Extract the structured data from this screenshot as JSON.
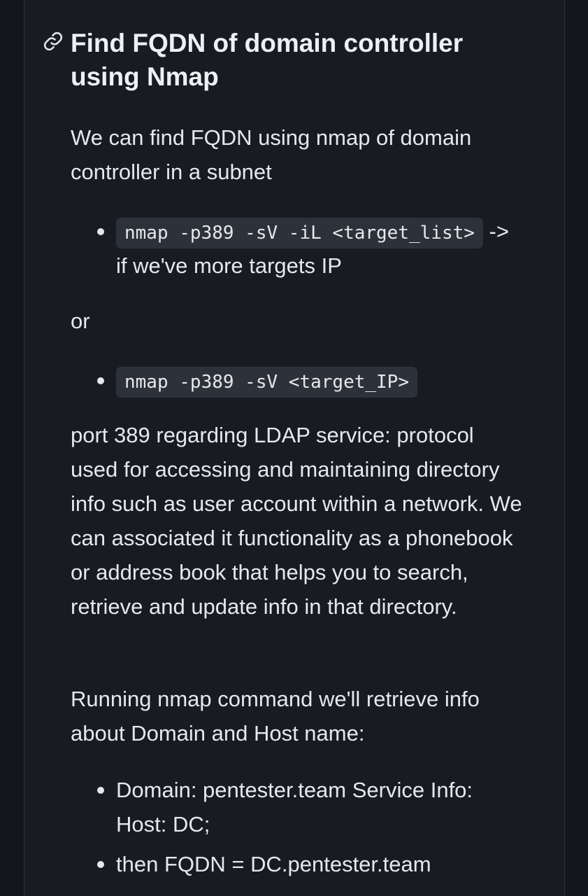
{
  "section": {
    "heading": "Find FQDN of domain controller using Nmap",
    "anchor_icon": "link-icon",
    "intro": "We can find FQDN using nmap of domain controller in a subnet",
    "list1": [
      {
        "code": "nmap -p389 -sV -iL <target_list>",
        "text": "-> if we've more targets IP"
      }
    ],
    "or_text": "or",
    "list2": [
      {
        "code": "nmap -p389 -sV <target_IP>"
      }
    ],
    "ldap_paragraph": "port 389 regarding LDAP service: protocol used for accessing and maintaining directory info such as user account within a network. We can associated it functionality as a phonebook or address book that helps you to search, retrieve and update info in that directory.",
    "running_paragraph": "Running nmap command we'll retrieve info about Domain and Host name:",
    "list3": [
      {
        "text": "Domain: pentester.team Service Info: Host: DC;"
      },
      {
        "text": "then FQDN = DC.pentester.team"
      }
    ]
  },
  "colors": {
    "background": "#181c22",
    "text": "#e6e8eb",
    "code_background": "#2d323a"
  }
}
